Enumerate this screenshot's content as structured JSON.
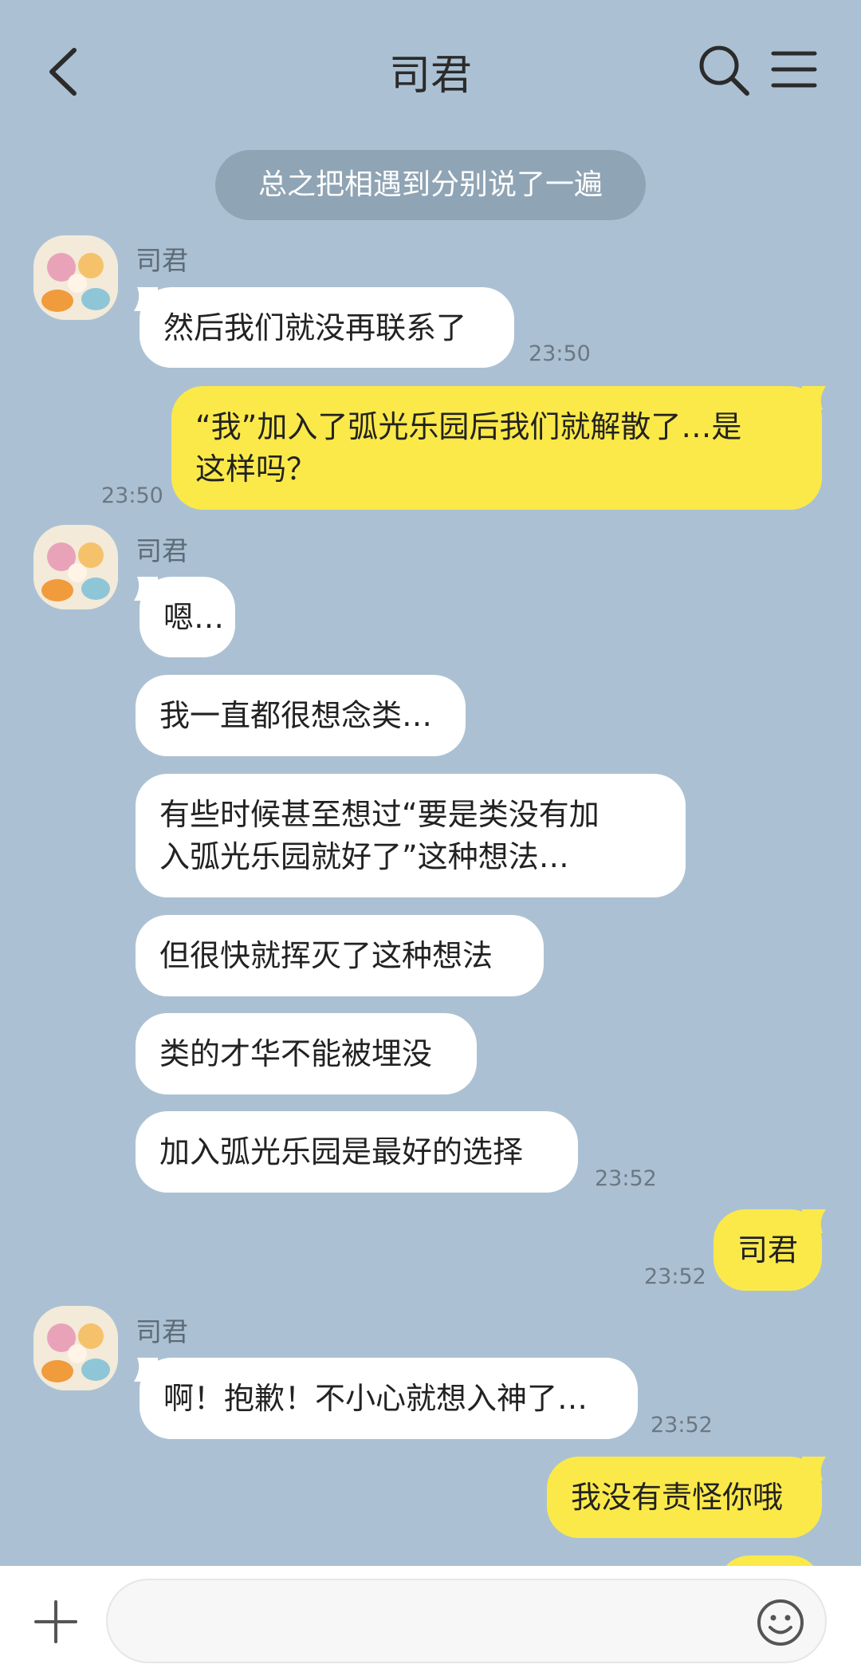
{
  "header": {
    "title": "司君"
  },
  "system_message": "总之把相遇到分别说了一遍",
  "messages": [
    {
      "sender": "司君",
      "text": "然后我们就没再联系了",
      "time": "23:50"
    },
    {
      "me": true,
      "line1": "“我”加入了弧光乐园后我们就解散了…是",
      "line2": "这样吗？",
      "time": "23:50"
    },
    {
      "sender": "司君",
      "text": "嗯…"
    },
    {
      "text": "我一直都很想念类…"
    },
    {
      "line1": "有些时候甚至想过“要是类没有加",
      "line2": "入弧光乐园就好了”这种想法…"
    },
    {
      "text": "但很快就挥灭了这种想法"
    },
    {
      "text": "类的才华不能被埋没"
    },
    {
      "text": "加入弧光乐园是最好的选择",
      "time": "23:52"
    },
    {
      "me": true,
      "text": "司君",
      "time": "23:52"
    },
    {
      "sender": "司君",
      "text": "啊！抱歉！不小心就想入神了…",
      "time": "23:52"
    },
    {
      "me": true,
      "text": "我没有责怪你哦"
    }
  ],
  "icons": {
    "back": "chevron-left-icon",
    "search": "search-icon",
    "menu": "hamburger-menu-icon",
    "plus": "plus-icon",
    "emoji": "smiley-icon"
  },
  "colors": {
    "background": "#abc1d3",
    "my_bubble": "#fbe94a",
    "their_bubble": "#ffffff",
    "system_pill": "#8fa4b4"
  }
}
